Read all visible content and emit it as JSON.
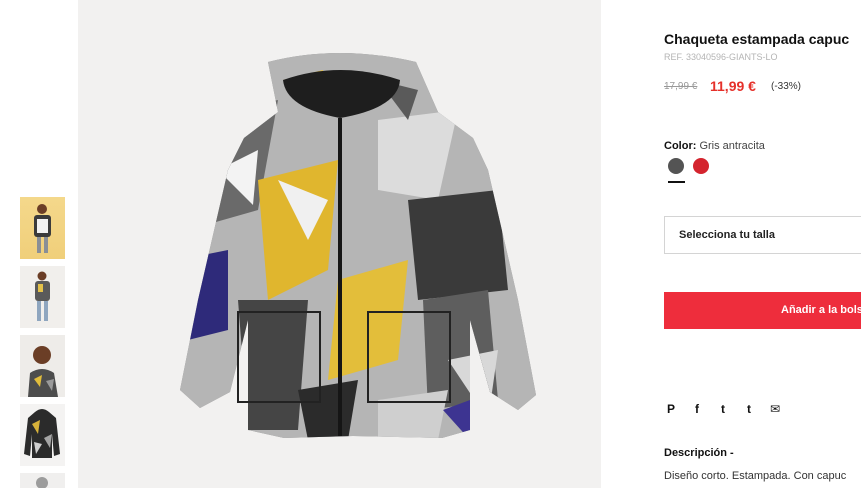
{
  "product": {
    "title": "Chaqueta estampada capuc",
    "ref": "REF. 33040596-GIANTS-LO",
    "old_price": "17,99 €",
    "new_price": "11,99 €",
    "discount": "(-33%)"
  },
  "color": {
    "label": "Color:",
    "value": "Gris antracita",
    "swatches": [
      "#545454",
      "#d4242e"
    ],
    "selected_index": 0
  },
  "size": {
    "placeholder": "Selecciona tu talla"
  },
  "cart": {
    "add_label": "Añadir a la bols"
  },
  "share": {
    "icons": [
      "pinterest-icon",
      "facebook-icon",
      "twitter-icon",
      "tumblr-icon",
      "email-icon"
    ],
    "glyphs": [
      "P",
      "f",
      "t",
      "t",
      "✉"
    ]
  },
  "description": {
    "title": "Descripción -",
    "text": "Diseño corto. Estampada. Con capuc"
  },
  "colors": {
    "accent": "#ee2d3c",
    "price": "#e5302a"
  }
}
